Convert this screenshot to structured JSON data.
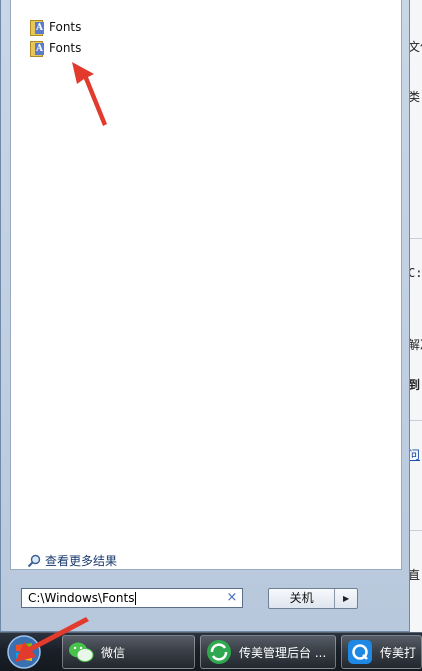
{
  "background_window": {
    "fragments": [
      "文件",
      "类",
      "C:",
      "解决",
      "到",
      "问",
      "直"
    ]
  },
  "start_menu": {
    "results": [
      {
        "label": "Fonts",
        "icon": "fonts-folder-icon"
      },
      {
        "label": "Fonts",
        "icon": "fonts-folder-icon"
      }
    ],
    "see_more_label": "查看更多结果",
    "search": {
      "value": "C:\\Windows\\Fonts",
      "clear_symbol": "×"
    },
    "shutdown": {
      "label": "关机",
      "arrow": "▶"
    }
  },
  "taskbar": {
    "items": [
      {
        "label": "微信",
        "icon": "wechat-icon"
      },
      {
        "label": "传美管理后台 ...",
        "icon": "green-refresh-icon"
      },
      {
        "label": "传美打",
        "icon": "blue-q-icon"
      }
    ]
  },
  "colors": {
    "annotation_red": "#e23a2c",
    "taskbar": "#1a2029",
    "menu_frame": "#b8c8dc"
  }
}
